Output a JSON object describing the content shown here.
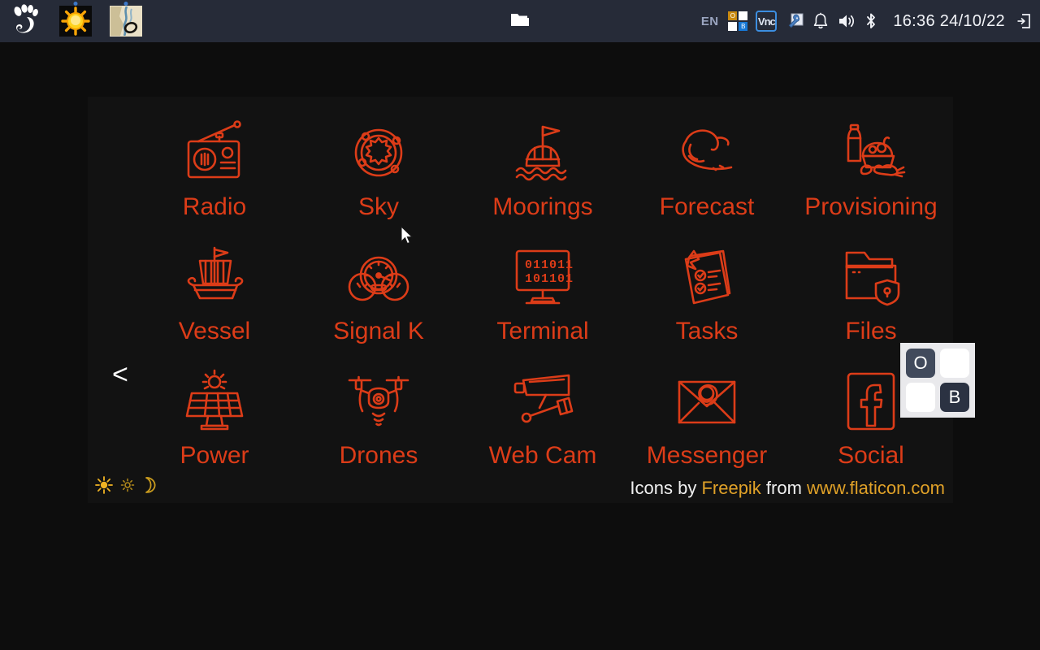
{
  "taskbar": {
    "launchers": [
      {
        "name": "gnome-logo",
        "icon": "gnome-foot-icon",
        "running": false
      },
      {
        "name": "weather-app",
        "icon": "sun-weather-icon",
        "running": true
      },
      {
        "name": "opencpn-app",
        "icon": "chart-map-icon",
        "running": true
      }
    ],
    "center_icon": "folder-icon",
    "tray": {
      "language": "EN",
      "workspace_cells": [
        {
          "label": "O",
          "style": "gold"
        },
        {
          "label": "",
          "style": "white"
        },
        {
          "label": "",
          "style": "white"
        },
        {
          "label": "B",
          "style": "blue"
        }
      ],
      "vnc_label": "Vnc",
      "icons": [
        "key-icon",
        "bell-icon",
        "volume-icon",
        "bluetooth-icon"
      ],
      "clock": "16:36 24/10/22",
      "logout_icon": "logout-icon"
    }
  },
  "panel": {
    "prev_arrow": "<",
    "items": [
      {
        "label": "Radio",
        "icon": "radio-icon"
      },
      {
        "label": "Sky",
        "icon": "sky-orbit-icon"
      },
      {
        "label": "Moorings",
        "icon": "mooring-buoy-icon"
      },
      {
        "label": "Forecast",
        "icon": "wave-icon"
      },
      {
        "label": "Provisioning",
        "icon": "groceries-icon"
      },
      {
        "label": "Vessel",
        "icon": "sailing-ship-icon"
      },
      {
        "label": "Signal K",
        "icon": "gauges-icon"
      },
      {
        "label": "Terminal",
        "icon": "binary-monitor-icon"
      },
      {
        "label": "Tasks",
        "icon": "checklist-icon"
      },
      {
        "label": "Files",
        "icon": "secure-folder-icon"
      },
      {
        "label": "Power",
        "icon": "solar-panel-icon"
      },
      {
        "label": "Drones",
        "icon": "drone-icon"
      },
      {
        "label": "Web Cam",
        "icon": "cctv-camera-icon"
      },
      {
        "label": "Messenger",
        "icon": "email-at-icon"
      },
      {
        "label": "Social",
        "icon": "facebook-icon"
      }
    ],
    "theme_icons": [
      "bright-sun-icon",
      "dim-sun-icon",
      "moon-icon"
    ],
    "attribution": {
      "part1": "Icons by ",
      "link1": "Freepik",
      "part2": " from ",
      "link2": "www.flaticon.com"
    }
  },
  "workspace_widget": {
    "cells": [
      {
        "label": "O",
        "style": "dark"
      },
      {
        "label": "",
        "style": "light"
      },
      {
        "label": "",
        "style": "light"
      },
      {
        "label": "B",
        "style": "darker"
      }
    ]
  },
  "colors": {
    "accent_red": "#dc3c18",
    "link_gold": "#e0a128",
    "panel_bg": "#121212",
    "desktop_bg": "#0d0d0d",
    "taskbar_bg": "#262b38"
  }
}
